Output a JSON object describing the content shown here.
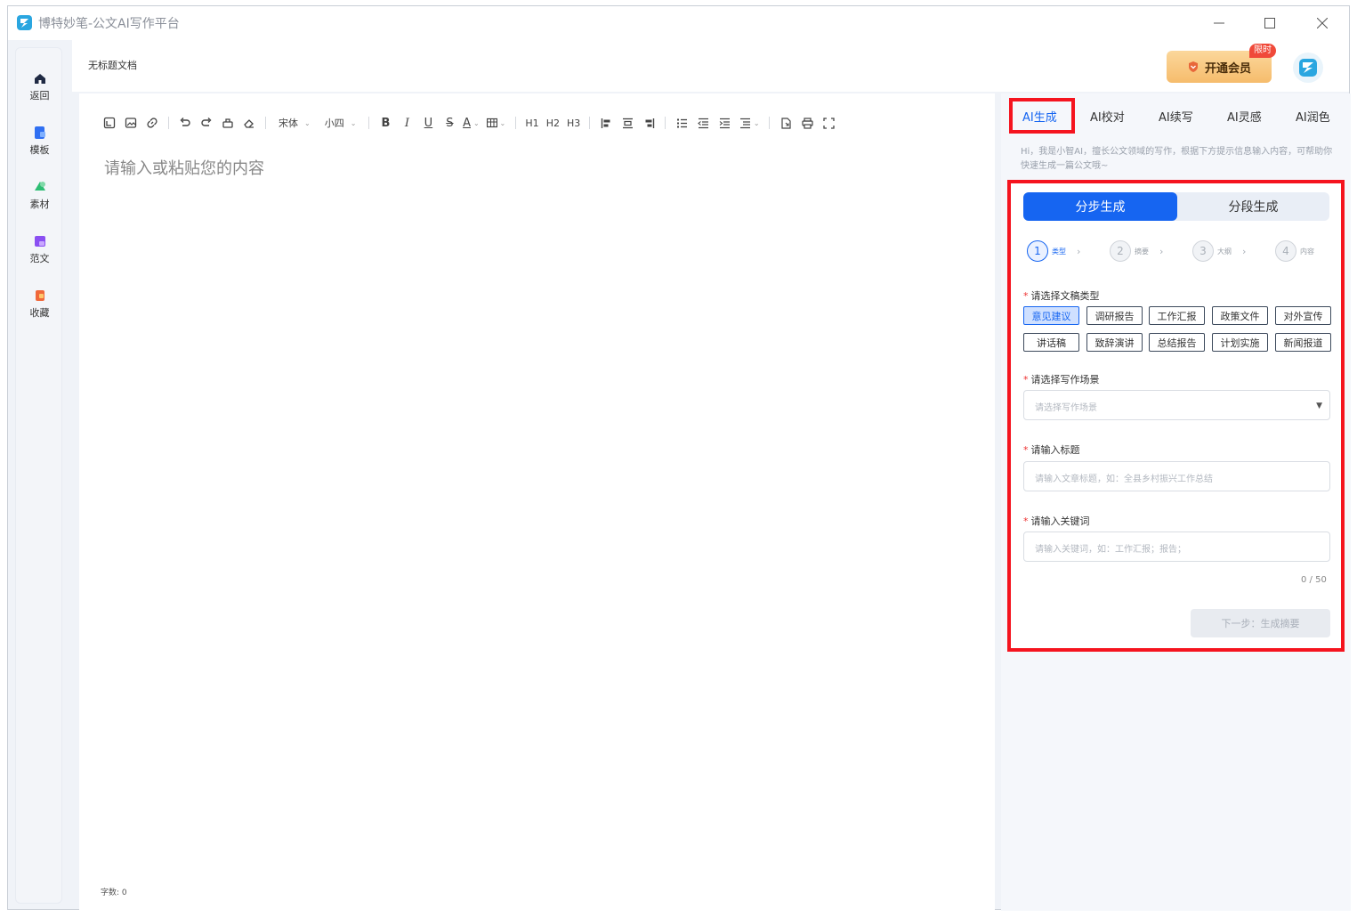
{
  "app": {
    "title": "博特妙笔-公文AI写作平台"
  },
  "sidebar": {
    "items": [
      {
        "label": "返回",
        "icon": "home-icon"
      },
      {
        "label": "模板",
        "icon": "template-icon"
      },
      {
        "label": "素材",
        "icon": "material-icon"
      },
      {
        "label": "范文",
        "icon": "sample-icon"
      },
      {
        "label": "收藏",
        "icon": "favorite-icon"
      }
    ]
  },
  "header": {
    "doc_title": "无标题文档",
    "vip_label": "开通会员",
    "vip_tag": "限时"
  },
  "toolbar": {
    "font": "宋体",
    "size": "小四",
    "h1": "H1",
    "h2": "H2",
    "h3": "H3"
  },
  "editor": {
    "placeholder": "请输入或粘贴您的内容",
    "word_count": "字数: 0"
  },
  "panel": {
    "tabs": [
      "AI生成",
      "AI校对",
      "AI续写",
      "AI灵感",
      "AI润色"
    ],
    "intro": "Hi，我是小智AI，擅长公文领域的写作，根据下方提示信息输入内容，可帮助你快速生成一篇公文哦~",
    "modes": {
      "step": "分步生成",
      "segment": "分段生成"
    },
    "steps": [
      {
        "num": "1",
        "label": "类型"
      },
      {
        "num": "2",
        "label": "摘要"
      },
      {
        "num": "3",
        "label": "大纲"
      },
      {
        "num": "4",
        "label": "内容"
      }
    ],
    "type_label": "请选择文稿类型",
    "types": [
      "意见建议",
      "调研报告",
      "工作汇报",
      "政策文件",
      "对外宣传",
      "讲话稿",
      "致辞演讲",
      "总结报告",
      "计划实施",
      "新闻报道"
    ],
    "scene_label": "请选择写作场景",
    "scene_placeholder": "请选择写作场景",
    "title_label": "请输入标题",
    "title_placeholder": "请输入文章标题，如：全县乡村振兴工作总结",
    "keyword_label": "请输入关键词",
    "keyword_placeholder": "请输入关键词，如：工作汇报；报告；",
    "counter": "0 / 50",
    "next_label": "下一步：生成摘要"
  },
  "colors": {
    "accent": "#1665f1",
    "highlight": "#f5141f",
    "vip": "#f6bc6c"
  }
}
